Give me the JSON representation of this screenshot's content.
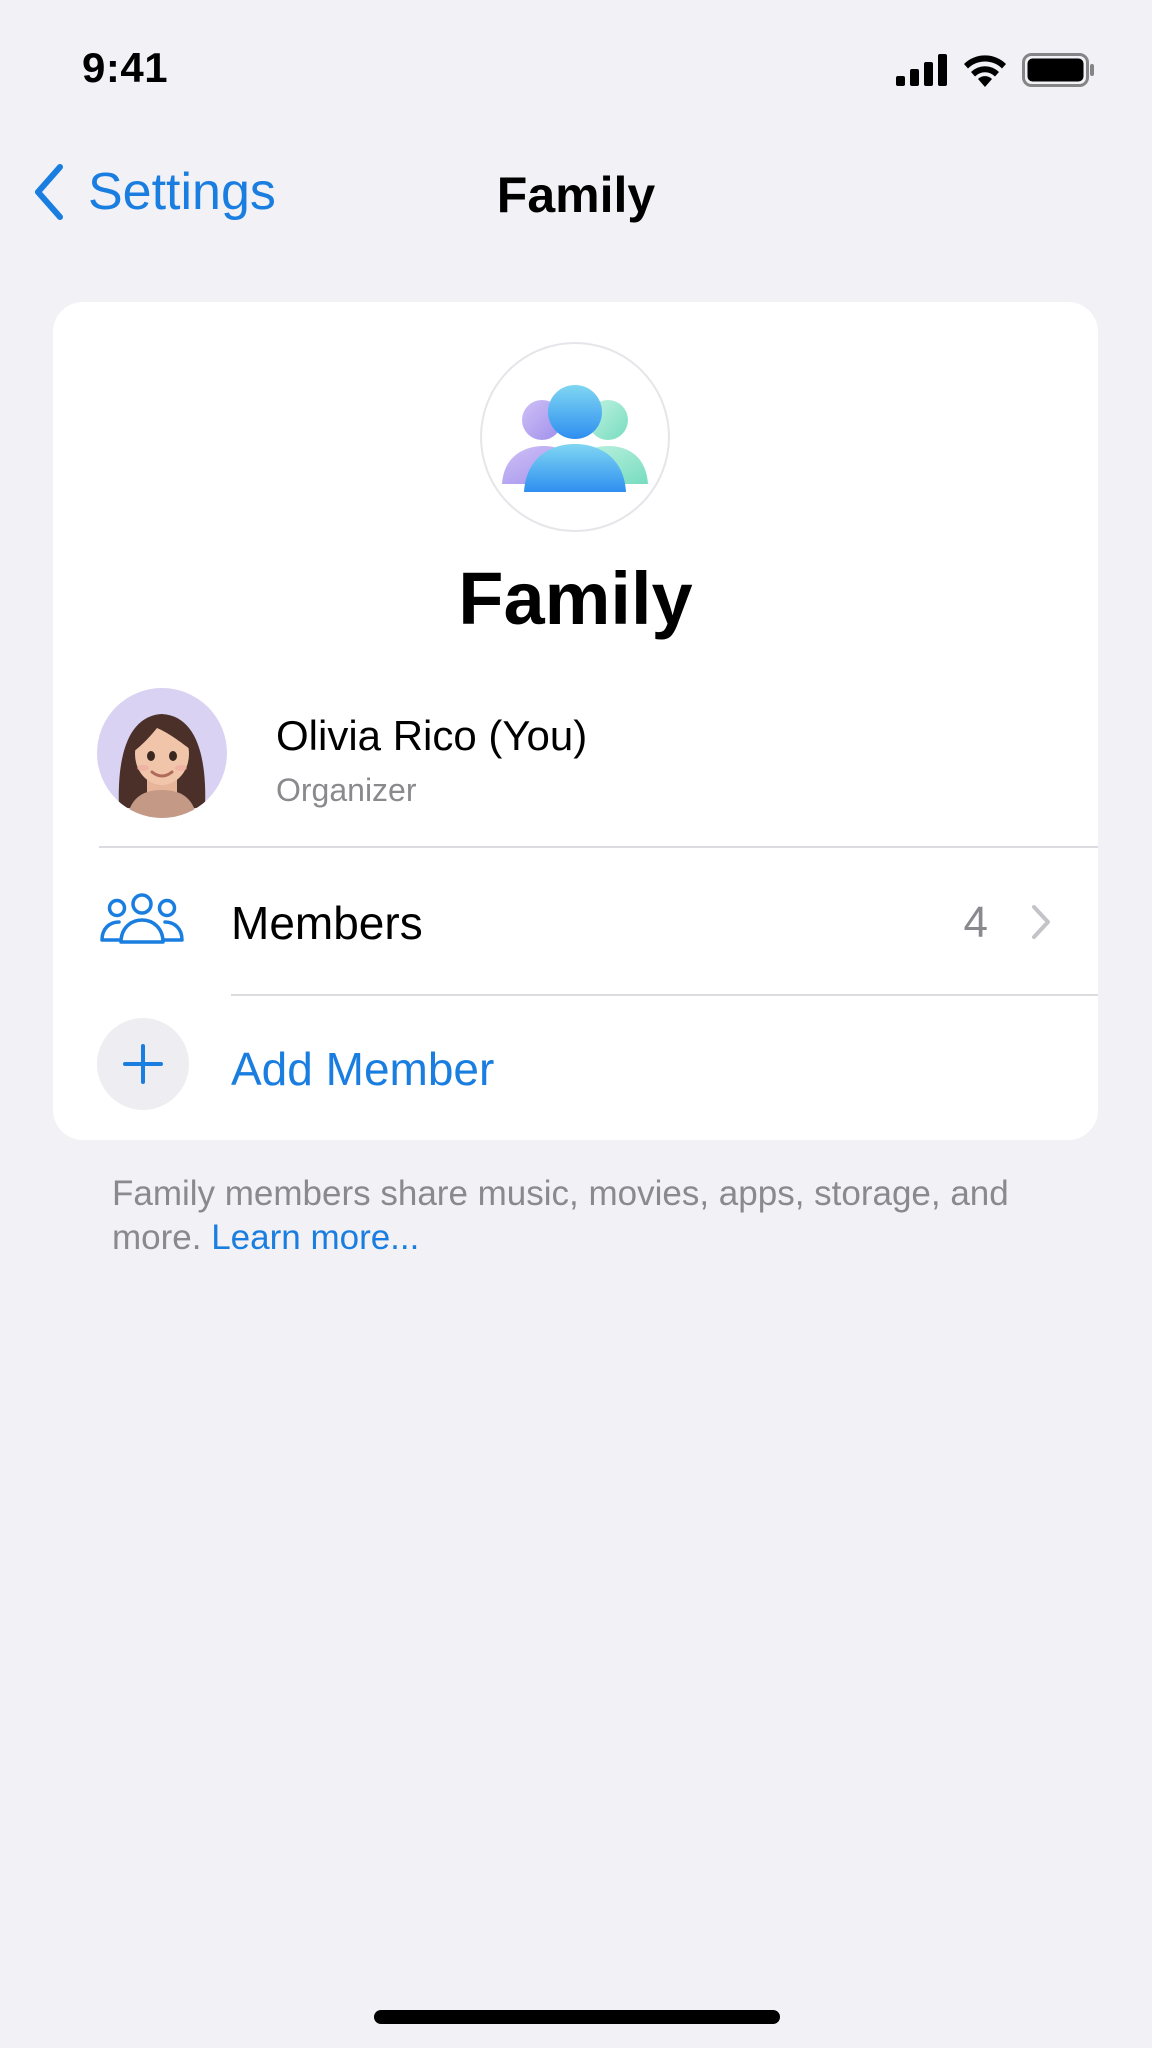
{
  "status_bar": {
    "time": "9:41",
    "icons": [
      "cellular-signal-icon",
      "wifi-icon",
      "battery-icon"
    ]
  },
  "nav": {
    "back_label": "Settings",
    "title": "Family"
  },
  "card": {
    "title": "Family",
    "organizer": {
      "name": "Olivia Rico (You)",
      "role": "Organizer"
    },
    "members": {
      "label": "Members",
      "count": "4"
    },
    "add_member": {
      "label": "Add Member"
    }
  },
  "footer": {
    "text": "Family members share music, movies, apps, storage, and more. ",
    "link": "Learn more..."
  },
  "colors": {
    "accent": "#1a7ee0",
    "background": "#f2f1f6",
    "secondary_text": "#8a8a8e"
  }
}
